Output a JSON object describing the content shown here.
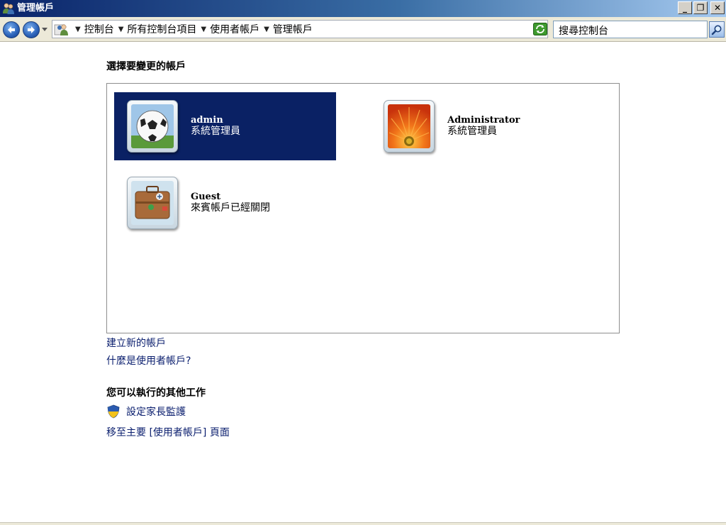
{
  "window": {
    "title": "管理帳戶",
    "controls": {
      "minimize": "_",
      "restore": "❐",
      "close": "✕"
    }
  },
  "address_bar": {
    "icon": "control-panel-icon",
    "breadcrumbs": [
      "控制台",
      "所有控制台項目",
      "使用者帳戶",
      "管理帳戶"
    ],
    "search_placeholder": "搜尋控制台"
  },
  "main": {
    "heading": "選擇要變更的帳戶",
    "accounts": [
      {
        "name": "admin",
        "role": "系統管理員",
        "picture": "soccer-ball-icon",
        "selected": true
      },
      {
        "name": "Administrator",
        "role": "系統管理員",
        "picture": "orange-flower-icon",
        "selected": false
      },
      {
        "name": "Guest",
        "role": "來賓帳戶已經關閉",
        "picture": "suitcase-icon",
        "selected": false
      }
    ],
    "links": {
      "create_account": "建立新的帳戶",
      "what_is_account": "什麼是使用者帳戶?"
    }
  },
  "other_tasks": {
    "heading": "您可以執行的其他工作",
    "parental_controls": "設定家長監護",
    "goto_main": "移至主要 [使用者帳戶] 頁面"
  },
  "colors": {
    "selected_account_bg": "#0a2164",
    "link": "#0a1e6e",
    "titlebar_start": "#0a246a",
    "titlebar_end": "#a6caf0"
  }
}
